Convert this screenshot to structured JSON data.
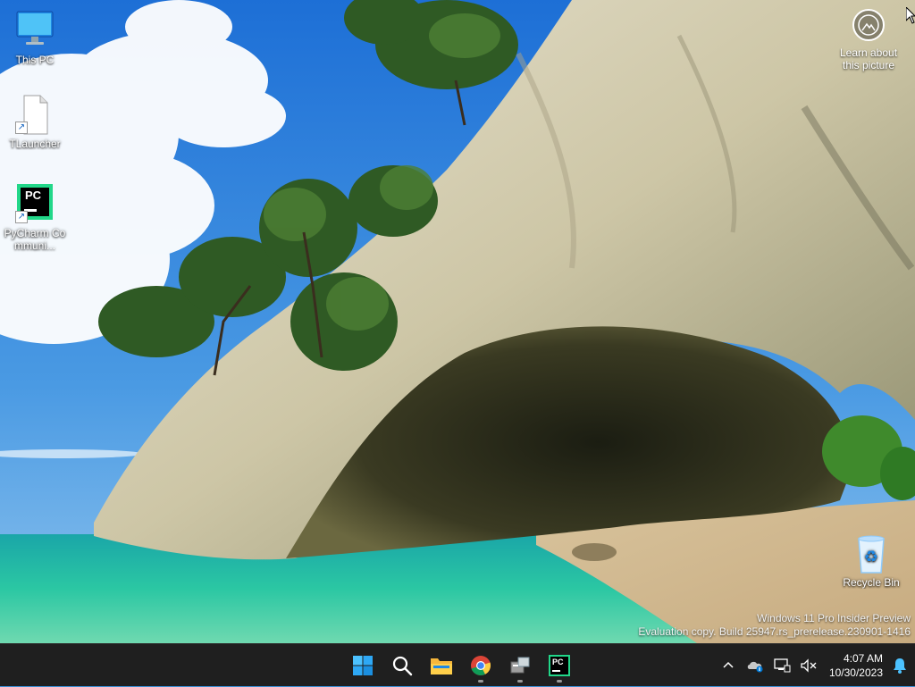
{
  "desktop": {
    "icons": [
      {
        "label": "This PC"
      },
      {
        "label": "TLauncher"
      },
      {
        "label": "PyCharm Communi...",
        "badge": "PC"
      },
      {
        "label": "Recycle Bin"
      }
    ],
    "spotlight": {
      "line1": "Learn about",
      "line2": "this picture"
    },
    "watermark": {
      "line1": "Windows 11 Pro Insider Preview",
      "line2": "Evaluation copy. Build 25947.rs_prerelease.230901-1416"
    }
  },
  "taskbar": {
    "pinned": [
      "windows-start-icon",
      "search-icon",
      "file-explorer-icon",
      "chrome-icon",
      "network-app-icon",
      "pycharm-icon"
    ],
    "pycharm_badge": "PC",
    "tray": {
      "icons": [
        "chevron-up-icon",
        "onedrive-icon",
        "network-icon",
        "volume-muted-icon"
      ],
      "time": "4:07 AM",
      "date": "10/30/2023"
    },
    "colors": {
      "background": "#1f1f1f",
      "accent": "#0078d4"
    }
  }
}
